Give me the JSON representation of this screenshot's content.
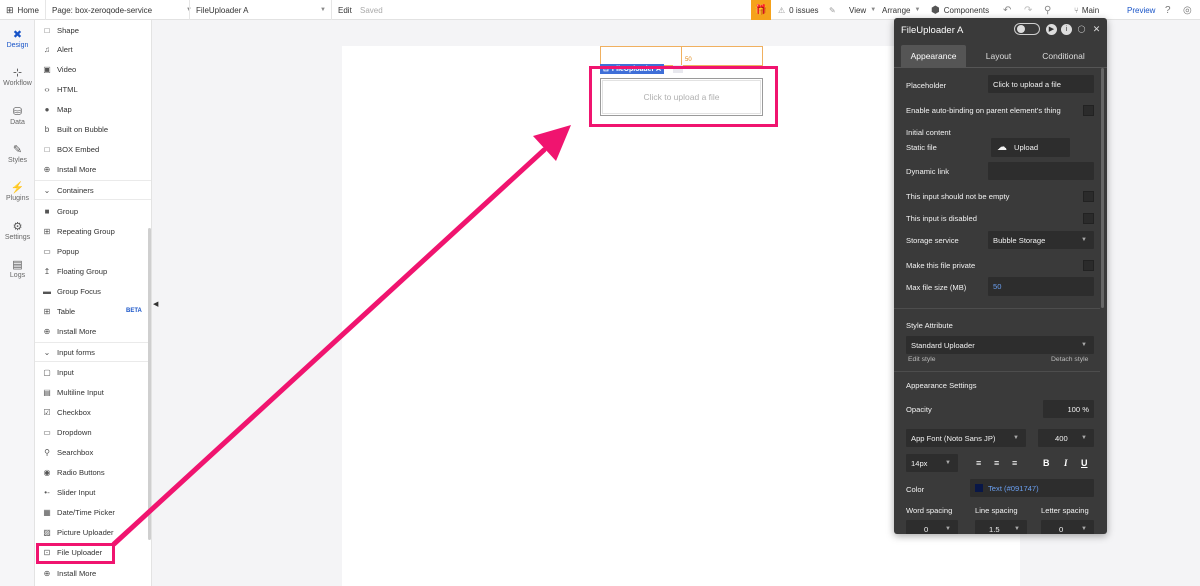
{
  "topbar": {
    "home": "Home",
    "page": "Page: box-zeroqode-service",
    "element": "FileUploader A",
    "edit": "Edit",
    "saved": "Saved",
    "issues": "0 issues",
    "view": "View",
    "arrange": "Arrange",
    "components": "Components",
    "branch": "Main",
    "preview": "Preview"
  },
  "leftnav": {
    "items": [
      {
        "label": "Design",
        "icon": "✖"
      },
      {
        "label": "Workflow",
        "icon": "⊹"
      },
      {
        "label": "Data",
        "icon": "⛁"
      },
      {
        "label": "Styles",
        "icon": "✎"
      },
      {
        "label": "Plugins",
        "icon": "⚡"
      },
      {
        "label": "Settings",
        "icon": "⚙"
      },
      {
        "label": "Logs",
        "icon": "▤"
      }
    ]
  },
  "palette": {
    "rows": [
      {
        "label": "Shape",
        "icon": "□"
      },
      {
        "label": "Alert",
        "icon": "♫"
      },
      {
        "label": "Video",
        "icon": "▣"
      },
      {
        "label": "HTML",
        "icon": "‹›"
      },
      {
        "label": "Map",
        "icon": "●"
      },
      {
        "label": "Built on Bubble",
        "icon": "b"
      },
      {
        "label": "BOX Embed",
        "icon": "□"
      },
      {
        "label": "Install More",
        "icon": "⊕"
      },
      {
        "label": "Containers",
        "icon": "⌄"
      },
      {
        "label": "Group",
        "icon": "■"
      },
      {
        "label": "Repeating Group",
        "icon": "⊞"
      },
      {
        "label": "Popup",
        "icon": "▭"
      },
      {
        "label": "Floating Group",
        "icon": "↥"
      },
      {
        "label": "Group Focus",
        "icon": "▬"
      },
      {
        "label": "Table",
        "icon": "⊞"
      },
      {
        "label": "Install More",
        "icon": "⊕"
      },
      {
        "label": "Input forms",
        "icon": "⌄"
      },
      {
        "label": "Input",
        "icon": "▢"
      },
      {
        "label": "Multiline Input",
        "icon": "▤"
      },
      {
        "label": "Checkbox",
        "icon": "☑"
      },
      {
        "label": "Dropdown",
        "icon": "▭"
      },
      {
        "label": "Searchbox",
        "icon": "⚲"
      },
      {
        "label": "Radio Buttons",
        "icon": "◉"
      },
      {
        "label": "Slider Input",
        "icon": "•-"
      },
      {
        "label": "Date/Time Picker",
        "icon": "▦"
      },
      {
        "label": "Picture Uploader",
        "icon": "▨"
      },
      {
        "label": "File Uploader",
        "icon": "⊡"
      },
      {
        "label": "Install More",
        "icon": "⊕"
      }
    ],
    "beta": "BETA"
  },
  "canvas": {
    "element_label": "FileUploader A",
    "guide_value": "50",
    "placeholder": "Click to upload a file"
  },
  "panel": {
    "title": "FileUploader A",
    "tabs": [
      "Appearance",
      "Layout",
      "Conditional"
    ],
    "placeholder_label": "Placeholder",
    "placeholder_value": "Click to upload a file",
    "autobinding": "Enable auto-binding on parent element's thing",
    "initial_content": "Initial content",
    "static_file": "Static file",
    "upload": "Upload",
    "dynamic_link": "Dynamic link",
    "not_empty": "This input should not be empty",
    "disabled": "This input is disabled",
    "storage_label": "Storage service",
    "storage_value": "Bubble Storage",
    "private": "Make this file private",
    "max_size_label": "Max file size (MB)",
    "max_size_value": "50",
    "style_attribute": "Style Attribute",
    "style_value": "Standard Uploader",
    "edit_style": "Edit style",
    "detach_style": "Detach style",
    "appearance_settings": "Appearance Settings",
    "opacity_label": "Opacity",
    "opacity_value": "100 %",
    "font_value": "App Font (Noto Sans JP)",
    "weight_value": "400",
    "size_value": "14px",
    "color_label": "Color",
    "color_value": "Text (#091747)",
    "word_spacing": "Word spacing",
    "line_spacing": "Line spacing",
    "letter_spacing": "Letter spacing",
    "word_value": "0",
    "line_value": "1.5",
    "letter_value": "0"
  },
  "colors": {
    "highlight": "#f0146f",
    "accent": "#1854c8",
    "panel_bg": "#3a3a3a",
    "text_token": "#091747"
  }
}
